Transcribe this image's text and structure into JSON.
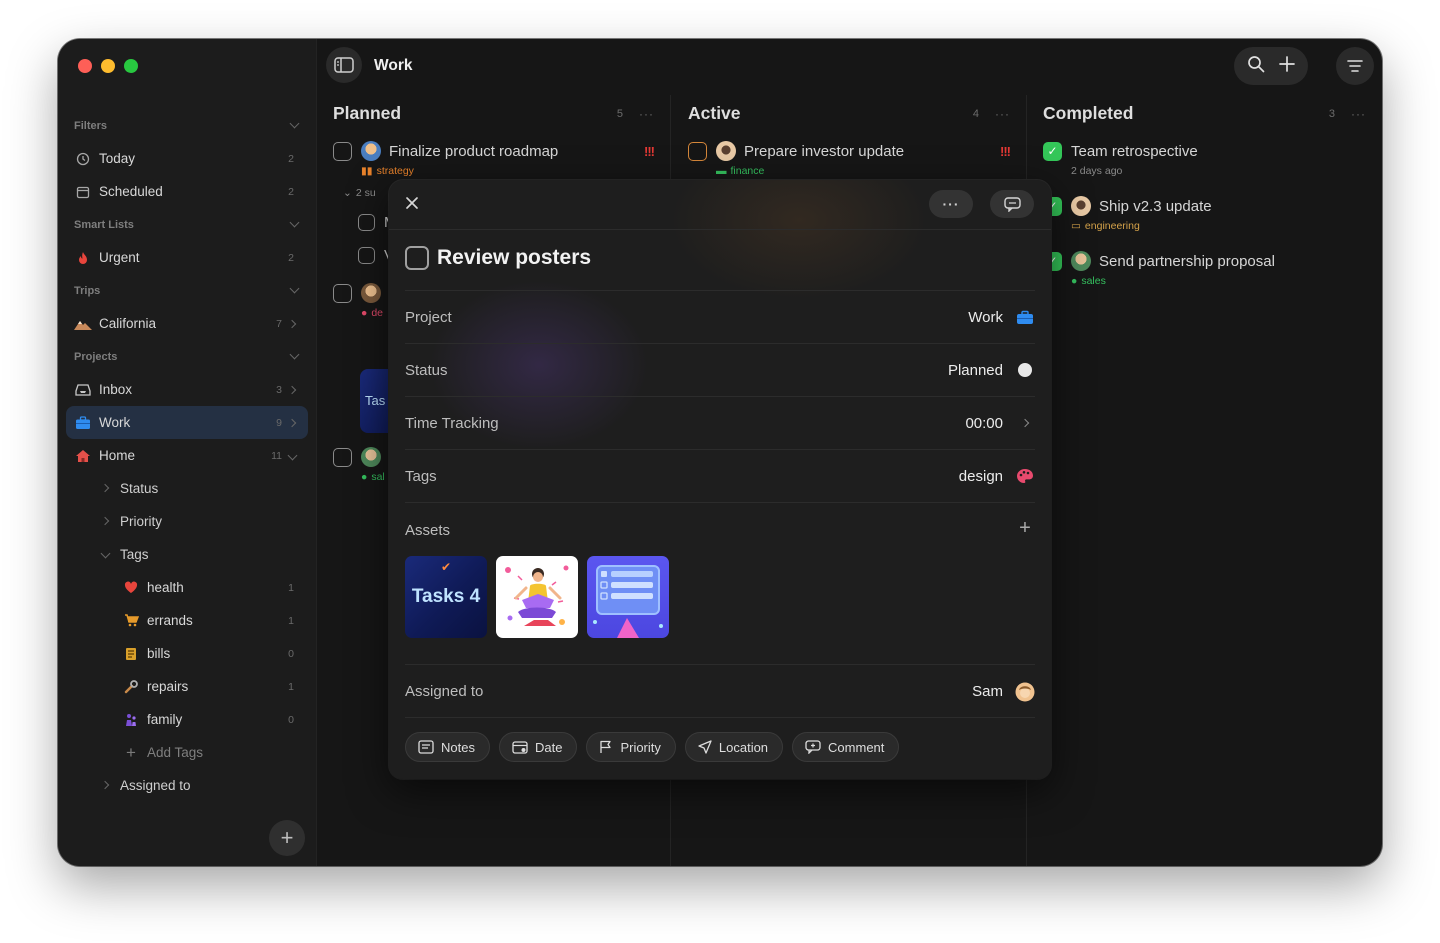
{
  "window": {
    "title": "Work"
  },
  "sidebar": {
    "sections": {
      "filters": "Filters",
      "smart_lists": "Smart Lists",
      "trips": "Trips",
      "projects": "Projects"
    },
    "filters": [
      {
        "label": "Today",
        "count": "2",
        "icon": "clock-icon"
      },
      {
        "label": "Scheduled",
        "count": "2",
        "icon": "calendar-icon"
      }
    ],
    "smart_lists": [
      {
        "label": "Urgent",
        "count": "2",
        "icon": "flame-icon"
      }
    ],
    "trips": [
      {
        "label": "California",
        "count": "7",
        "icon": "mountain-icon"
      }
    ],
    "projects": [
      {
        "label": "Inbox",
        "count": "3",
        "icon": "inbox-icon"
      },
      {
        "label": "Work",
        "count": "9",
        "icon": "briefcase-icon"
      },
      {
        "label": "Home",
        "count": "11",
        "icon": "house-icon"
      }
    ],
    "home_children": {
      "status": "Status",
      "priority": "Priority",
      "tags": "Tags",
      "assigned_to": "Assigned to"
    },
    "tags": [
      {
        "label": "health",
        "count": "1",
        "icon": "heart-icon"
      },
      {
        "label": "errands",
        "count": "1",
        "icon": "cart-icon"
      },
      {
        "label": "bills",
        "count": "0",
        "icon": "receipt-icon"
      },
      {
        "label": "repairs",
        "count": "1",
        "icon": "wrench-icon"
      },
      {
        "label": "family",
        "count": "0",
        "icon": "family-icon"
      }
    ],
    "add_tags": "Add Tags",
    "accent": "#243043"
  },
  "columns": [
    {
      "title": "Planned",
      "count": "5"
    },
    {
      "title": "Active",
      "count": "4"
    },
    {
      "title": "Completed",
      "count": "3"
    }
  ],
  "planned_tasks": {
    "t1": {
      "title": "Finalize product roadmap",
      "tag": "strategy",
      "priority": "!!!"
    },
    "subtasks": "2 su",
    "t2": {
      "title": "M"
    },
    "t3": {
      "title": "V"
    },
    "t4_tag": "de",
    "t5_tag": "sal",
    "card_text": "Tas"
  },
  "active_tasks": {
    "t1": {
      "title": "Prepare investor update",
      "tag": "finance",
      "priority": "!!!"
    }
  },
  "completed_tasks": [
    {
      "title": "Team retrospective",
      "meta": "2 days ago"
    },
    {
      "title": "Ship v2.3 update",
      "meta": "engineering"
    },
    {
      "title": "Send partnership proposal",
      "meta": "sales"
    }
  ],
  "modal": {
    "title": "Review posters",
    "fields": {
      "project": {
        "label": "Project",
        "value": "Work"
      },
      "status": {
        "label": "Status",
        "value": "Planned"
      },
      "time": {
        "label": "Time Tracking",
        "value": "00:00"
      },
      "tags": {
        "label": "Tags",
        "value": "design"
      },
      "assets": {
        "label": "Assets"
      },
      "assigned": {
        "label": "Assigned to",
        "value": "Sam"
      }
    },
    "asset_thumb_text": "Tasks 4",
    "actions": [
      "Notes",
      "Date",
      "Priority",
      "Location",
      "Comment"
    ]
  }
}
